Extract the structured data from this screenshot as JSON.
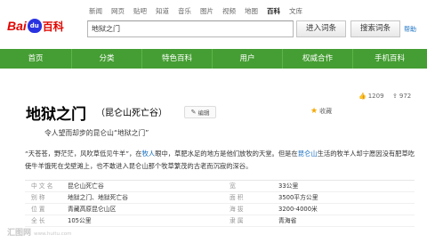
{
  "topnav": [
    "新闻",
    "网页",
    "贴吧",
    "知道",
    "音乐",
    "图片",
    "视频",
    "地图",
    "百科",
    "文库"
  ],
  "topnav_active": "百科",
  "logo": {
    "bai": "Bai",
    "du": "du",
    "baike": "百科"
  },
  "search": {
    "value": "地狱之门"
  },
  "buttons": {
    "enter": "进入词条",
    "search": "搜索词条",
    "help": "帮助"
  },
  "navbar": [
    "首页",
    "分类",
    "特色百科",
    "用户",
    "权威合作",
    "手机百科"
  ],
  "entry": {
    "title": "地狱之门",
    "subtitle": "（昆仑山死亡谷）",
    "edit": "编辑",
    "collect": "收藏",
    "likes": "1209",
    "shares": "972",
    "quote": "令人望而却步的昆仑山“地狱之门”",
    "summary": {
      "part1": "“天苍苍，野茫茫，风吹草低见牛羊”，在",
      "link1": "牧人",
      "part2": "眼中，草肥水足的地方是他们放牧的天堂。但是在",
      "link2": "昆仑山",
      "part3": "生活的牧羊人却宁愿因没有肥草吃使牛羊饿死在戈壁滩上，也不敢进入昆仑山那个牧草繁茂的古老而沉寂的深谷。"
    }
  },
  "infobox": [
    {
      "k1": "中文名",
      "v1": "昆仑山死亡谷",
      "k2": "宽",
      "v2": "33公里"
    },
    {
      "k1": "别称",
      "v1": "地狱之门、地狱死亡谷",
      "k2": "面积",
      "v2": "3500平方公里"
    },
    {
      "k1": "位置",
      "v1": "青藏高原昆仑山区",
      "k2": "海拔",
      "v2": "3200-4000米"
    },
    {
      "k1": "全长",
      "v1": "105公里",
      "k2": "隶属",
      "v2": "青海省"
    }
  ],
  "watermark": {
    "main": "汇图网",
    "sub": "www.huitu.com"
  }
}
